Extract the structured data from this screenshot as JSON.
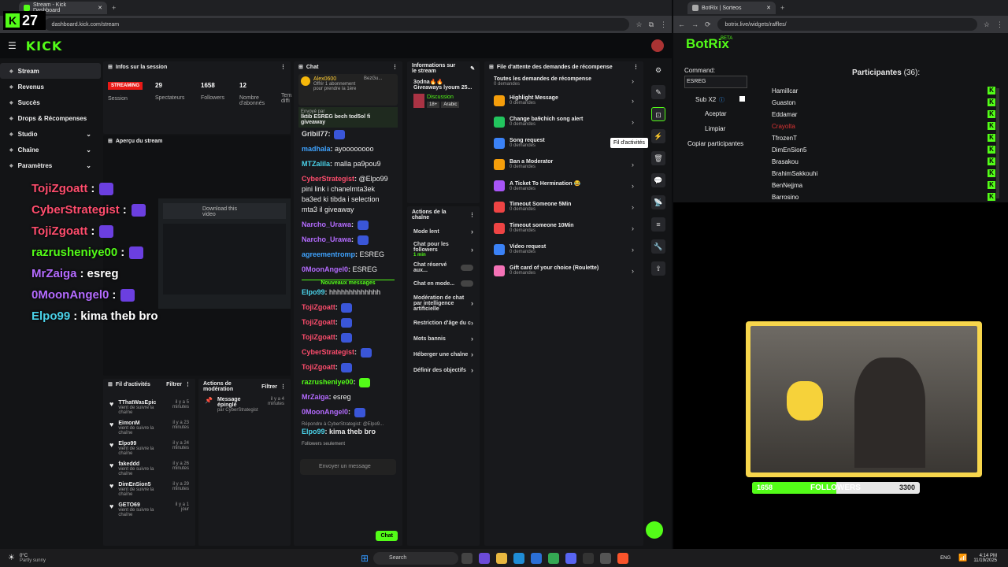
{
  "left_browser": {
    "tab_title": "Stream - Kick Dashboard",
    "url": "dashboard.kick.com/stream",
    "badge_count": "27"
  },
  "right_browser": {
    "tab_title": "BotRix | Sorteos",
    "url": "botrix.live/widgets/raffles/"
  },
  "kick": {
    "logo": "KICK"
  },
  "sidebar": [
    {
      "label": "Stream",
      "active": true
    },
    {
      "label": "Revenus"
    },
    {
      "label": "Succès"
    },
    {
      "label": "Drops & Récompenses"
    },
    {
      "label": "Studio"
    },
    {
      "label": "Chaîne"
    },
    {
      "label": "Paramètres"
    }
  ],
  "session": {
    "title": "Infos sur la session",
    "live": "STREAMING",
    "live_sub": "Session",
    "spectators": "29",
    "spectators_label": "Spectateurs",
    "followers": "1658",
    "followers_label": "Followers",
    "subs": "12",
    "subs_label": "Nombre d'abonnés",
    "time_label": "Tem... diffi"
  },
  "preview": {
    "title": "Aperçu du stream",
    "download": "Download this video"
  },
  "overlay_chat": [
    {
      "user": "TojiZgoatt",
      "color": "red",
      "msg": ""
    },
    {
      "user": "CyberStrategist",
      "color": "red",
      "msg": ""
    },
    {
      "user": "TojiZgoatt",
      "color": "red",
      "msg": ""
    },
    {
      "user": "razrusheniye00",
      "color": "green",
      "msg": ""
    },
    {
      "user": "MrZaiga",
      "color": "pur",
      "msg": "esreg"
    },
    {
      "user": "0MoonAngel0",
      "color": "pur",
      "msg": ""
    },
    {
      "user": "Elpo99",
      "color": "teal",
      "msg": "kima theb bro"
    }
  ],
  "chat": {
    "title": "Chat",
    "pinned_user": "Alex0600",
    "pinned_user2": "BezGu...",
    "pinned_note": "Offrir 1 abonnement pour prendre la 1ère",
    "sent_by": "Envoyé par",
    "pinned_msg": "lktib ESREG bech tod5ol fi giveaway",
    "lines": [
      {
        "user": "Gribil77",
        "color": "",
        "msg": ""
      },
      {
        "user": "madhala",
        "color": "blue",
        "msg": "ayoooooooo"
      },
      {
        "user": "MTZalila",
        "color": "teal",
        "msg": "malla pa9pou9"
      },
      {
        "user": "CyberStrategist",
        "color": "red",
        "msg": "@Elpo99 pini link i chanelmta3ek ba3ed ki tibda i selection mta3 il giveaway"
      },
      {
        "user": "Narcho_Urawa",
        "color": "pur",
        "msg": ""
      },
      {
        "user": "Narcho_Urawa",
        "color": "pur",
        "msg": ""
      },
      {
        "user": "agreementromp",
        "color": "blue",
        "msg": "ESREG"
      },
      {
        "user": "0MoonAngel0",
        "color": "pur",
        "msg": "ESREG"
      }
    ],
    "new_messages": "Nouveaux messages",
    "lines2": [
      {
        "user": "Elpo99",
        "color": "teal",
        "msg": "hhhhhhhhhhhhh"
      },
      {
        "user": "TojiZgoatt",
        "color": "red",
        "msg": ""
      },
      {
        "user": "TojiZgoatt",
        "color": "red",
        "msg": ""
      },
      {
        "user": "TojiZgoatt",
        "color": "red",
        "msg": ""
      },
      {
        "user": "CyberStrategist",
        "color": "red",
        "msg": ""
      },
      {
        "user": "TojiZgoatt",
        "color": "red",
        "msg": ""
      },
      {
        "user": "razrusheniye00",
        "color": "green",
        "msg": ""
      },
      {
        "user": "MrZaiga",
        "color": "pur",
        "msg": "esreg"
      },
      {
        "user": "0MoonAngel0",
        "color": "pur",
        "msg": ""
      }
    ],
    "reply_note": "Répondre à CyberStrategist: @Elpo9...",
    "last": {
      "user": "Elpo99",
      "msg": "kima theb bro"
    },
    "followers_only": "Followers seulement",
    "input_placeholder": "Envoyer un message",
    "send": "Chat"
  },
  "info": {
    "title": "Informations sur le stream",
    "stream_title": "3odna🔥🔥 Giveaways lyoum 25...",
    "category": "Discussion",
    "tag1": "18+",
    "tag2": "Arabic"
  },
  "actions": {
    "title": "Actions de la chaîne",
    "items": [
      {
        "label": "Mode lent"
      },
      {
        "label": "Chat pour les followers",
        "sub": "1 min"
      },
      {
        "label": "Chat réservé aux..."
      },
      {
        "label": "Chat en mode..."
      },
      {
        "label": "Modération de chat par intelligence artificielle"
      },
      {
        "label": "Restriction d'âge du c"
      },
      {
        "label": "Mots bannis"
      },
      {
        "label": "Héberger une chaîne"
      },
      {
        "label": "Définir des objectifs"
      }
    ]
  },
  "rewards": {
    "title": "File d'attente des demandes de récompense",
    "all": "Toutes les demandes de récompense",
    "zero": "0 demandes",
    "items": [
      {
        "label": "Highlight Message",
        "color": "#f59e0b"
      },
      {
        "label": "Change ba9chich song alert",
        "color": "#22c55e"
      },
      {
        "label": "Song request",
        "color": "#3b82f6"
      },
      {
        "label": "Ban a Moderator",
        "color": "#f59e0b"
      },
      {
        "label": "A Ticket To Hermination 😂",
        "color": "#a855f7"
      },
      {
        "label": "Timeout Someone 5Min",
        "color": "#ef4444"
      },
      {
        "label": "Timeout someone 10Min",
        "color": "#ef4444"
      },
      {
        "label": "Video request",
        "color": "#3b82f6"
      },
      {
        "label": "Gift card of your choice (Roulette)",
        "color": "#f472b6"
      }
    ],
    "items_sub": "0 demandes"
  },
  "tooltip": "Fil d'activités",
  "activity": {
    "title": "Fil d'activités",
    "filter": "Filtrer",
    "sub": "vient de suivre la chaîne",
    "items": [
      {
        "name": "TThatWasEpic",
        "time": "il y a 5 minutes"
      },
      {
        "name": "EimonM",
        "time": "il y a 23 minutes"
      },
      {
        "name": "Elpo99",
        "time": "il y a 24 minutes"
      },
      {
        "name": "fakeddd",
        "time": "il y a 26 minutes"
      },
      {
        "name": "DimEnSion5",
        "time": "il y a 29 minutes"
      },
      {
        "name": "GETO69",
        "time": "il y a 1 jour"
      }
    ]
  },
  "modactions": {
    "title": "Actions de modération",
    "filter": "Filtrer",
    "item": "Message épinglé",
    "by": "par CyberStrategist",
    "time": "il y a 4 minutes"
  },
  "botrix": {
    "logo": "BotRix",
    "beta": "BETA",
    "command_label": "Command:",
    "command_value": "ESREG",
    "sub_label": "Sub X2",
    "accept": "Aceptar",
    "clear": "Limpiar",
    "copy": "Copiar participantes",
    "participants_title": "Participantes",
    "participants_count": "(36):",
    "participants": [
      "Hamillcar",
      "Guaston",
      "Eddamar",
      "Crayolta",
      "TfrozenT",
      "DimEnSion5",
      "Brasakou",
      "BrahimSakkouhi",
      "BenNejjma",
      "Barrosino"
    ]
  },
  "followers_bar": {
    "current": "1658",
    "label": "FOLLOWERS",
    "goal": "3300",
    "progress": 0.502
  },
  "taskbar": {
    "weather": "0°C",
    "weather_sub": "Partly sunny",
    "search": "Search",
    "lang": "ENG",
    "time": "4:14 PM",
    "date": "11/19/2025"
  }
}
